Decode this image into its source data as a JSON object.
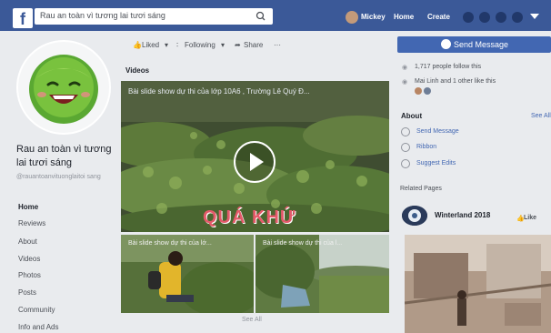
{
  "topbar": {
    "search_value": "Rau an toàn vì tương lai tươi sáng",
    "user_name": "Mickey",
    "home": "Home",
    "create": "Create"
  },
  "page": {
    "name": "Rau an toàn vì tương lai tươi sáng",
    "handle": "@rauantoanvituonglaitoi sang"
  },
  "left_nav": [
    "Home",
    "Reviews",
    "About",
    "Videos",
    "Photos",
    "Posts",
    "Community",
    "Info and Ads"
  ],
  "actions": {
    "liked": "Liked",
    "following": "Following",
    "share": "Share",
    "more": "···"
  },
  "videos": {
    "section_title": "Videos",
    "main_title": "Bài slide show dự thi của lớp 10A6 , Trường Lê Quý Đ...",
    "overlay_text": "QUÁ KHỨ",
    "thumb1_title": "Bài slide show dự thi của lớ...",
    "thumb2_title": "Bài slide show dự thi của l...",
    "see_all": "See All"
  },
  "right": {
    "send_message": "Send Message",
    "follow_count": "1,717 people follow this",
    "friends_like": "Mai Linh and 1 other like this",
    "about_title": "About",
    "about_see_all": "See All",
    "about_rows": [
      "Send Message",
      "Ribbon",
      "Suggest Edits"
    ],
    "related_title": "Related Pages",
    "related_name": "Winterland 2018",
    "like": "Like"
  },
  "colors": {
    "facebook_blue": "#3b5998",
    "button_blue": "#4267b2",
    "background": "#e9ebee"
  }
}
